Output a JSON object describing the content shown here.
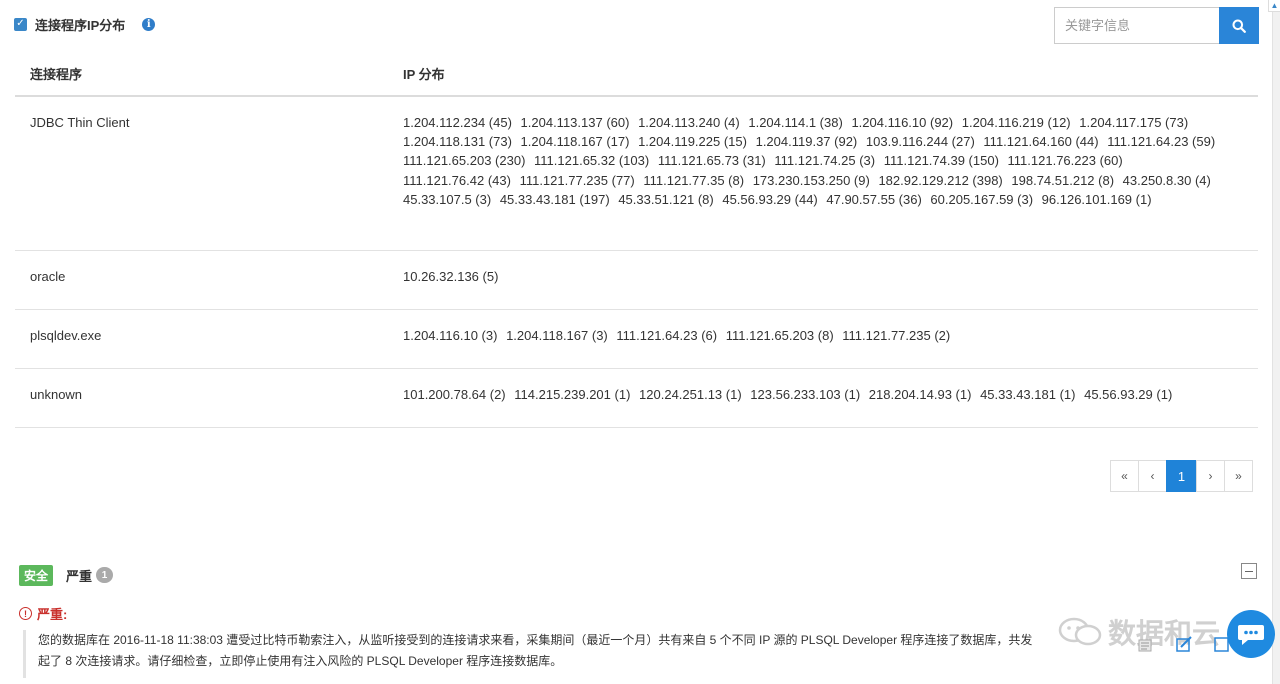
{
  "panel": {
    "title": "连接程序IP分布",
    "info_icon": "i"
  },
  "search": {
    "placeholder": "关键字信息"
  },
  "table": {
    "headers": {
      "program": "连接程序",
      "ip": "IP 分布"
    },
    "rows": [
      {
        "program": "JDBC Thin Client",
        "ips": [
          "1.204.112.234 (45)",
          "1.204.113.137 (60)",
          "1.204.113.240 (4)",
          "1.204.114.1 (38)",
          "1.204.116.10 (92)",
          "1.204.116.219 (12)",
          "1.204.117.175 (73)",
          "1.204.118.131 (73)",
          "1.204.118.167 (17)",
          "1.204.119.225 (15)",
          "1.204.119.37 (92)",
          "103.9.116.244 (27)",
          "111.121.64.160 (44)",
          "111.121.64.23 (59)",
          "111.121.65.203 (230)",
          "111.121.65.32 (103)",
          "111.121.65.73 (31)",
          "111.121.74.25 (3)",
          "111.121.74.39 (150)",
          "111.121.76.223 (60)",
          "111.121.76.42 (43)",
          "111.121.77.235 (77)",
          "111.121.77.35 (8)",
          "173.230.153.250 (9)",
          "182.92.129.212 (398)",
          "198.74.51.212 (8)",
          "43.250.8.30 (4)",
          "45.33.107.5 (3)",
          "45.33.43.181 (197)",
          "45.33.51.121 (8)",
          "45.56.93.29 (44)",
          "47.90.57.55 (36)",
          "60.205.167.59 (3)",
          "96.126.101.169 (1)"
        ]
      },
      {
        "program": "oracle",
        "ips": [
          "10.26.32.136 (5)"
        ]
      },
      {
        "program": "plsqldev.exe",
        "ips": [
          "1.204.116.10 (3)",
          "1.204.118.167 (3)",
          "111.121.64.23 (6)",
          "111.121.65.203 (8)",
          "111.121.77.235 (2)"
        ]
      },
      {
        "program": "unknown",
        "ips": [
          "101.200.78.64 (2)",
          "114.215.239.201 (1)",
          "120.24.251.13 (1)",
          "123.56.233.103 (1)",
          "218.204.14.93 (1)",
          "45.33.43.181 (1)",
          "45.56.93.29 (1)"
        ]
      }
    ]
  },
  "pagination": {
    "first": "«",
    "prev": "‹",
    "current": "1",
    "next": "›",
    "last": "»"
  },
  "alert": {
    "category": "安全",
    "severity": "严重",
    "count": "1",
    "severe_title": "严重:",
    "message": "您的数据库在 2016-11-18 11:38:03 遭受过比特币勒索注入，从监听接受到的连接请求来看，采集期间（最近一个月）共有来自 5 个不同 IP 源的 PLSQL Developer 程序连接了数据库，共发起了 8 次连接请求。请仔细检查，立即停止使用有注入风险的 PLSQL Developer 程序连接数据库。"
  },
  "watermark": {
    "text": "数据和云"
  },
  "colors": {
    "primary": "#1f83d8",
    "safe": "#5cb85c",
    "danger": "#c9302c"
  }
}
